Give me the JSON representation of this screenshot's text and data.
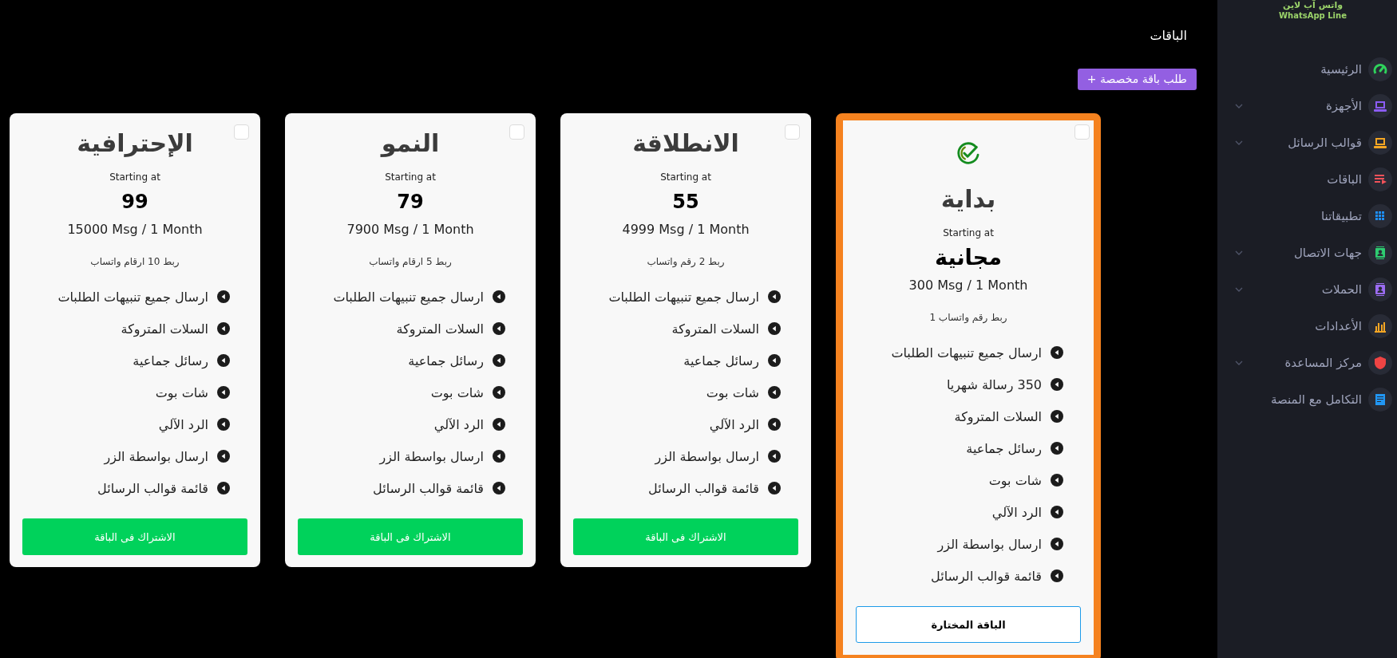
{
  "page_title": "الباقات",
  "custom_plan_button": "طلب باقة مخصصة +",
  "plans": [
    {
      "title": "بداية",
      "selected": true,
      "checked": false,
      "starting_label": "Starting at",
      "price": "مجانية",
      "quota": "300 Msg / 1 Month",
      "numbers": "ربط رقم واتساب 1",
      "features": [
        "ارسال جميع تنبيهات الطلبات",
        "350 رسالة شهريا",
        "السلات المتروكة",
        "رسائل جماعية",
        "شات بوت",
        "الرد الآلي",
        "ارسال بواسطة الزر",
        "قائمة قوالب الرسائل"
      ],
      "button": "الباقة المختارة"
    },
    {
      "title": "الانطلاقة",
      "selected": false,
      "checked": false,
      "starting_label": "Starting at",
      "price": "55",
      "quota": "4999 Msg / 1 Month",
      "numbers": "ربط 2 رقم واتساب",
      "features": [
        "ارسال جميع تنبيهات الطلبات",
        "السلات المتروكة",
        "رسائل جماعية",
        "شات بوت",
        "الرد الآلي",
        "ارسال بواسطة الزر",
        "قائمة قوالب الرسائل"
      ],
      "button": "الاشتراك فى الباقة"
    },
    {
      "title": "النمو",
      "selected": false,
      "checked": false,
      "starting_label": "Starting at",
      "price": "79",
      "quota": "7900 Msg / 1 Month",
      "numbers": "ربط 5 ارقام واتساب",
      "features": [
        "ارسال جميع تنبيهات الطلبات",
        "السلات المتروكة",
        "رسائل جماعية",
        "شات بوت",
        "الرد الآلي",
        "ارسال بواسطة الزر",
        "قائمة قوالب الرسائل"
      ],
      "button": "الاشتراك فى الباقة"
    },
    {
      "title": "الإحترافية",
      "selected": false,
      "checked": false,
      "starting_label": "Starting at",
      "price": "99",
      "quota": "15000 Msg / 1 Month",
      "numbers": "ربط 10 ارقام واتساب",
      "features": [
        "ارسال جميع تنبيهات الطلبات",
        "السلات المتروكة",
        "رسائل جماعية",
        "شات بوت",
        "الرد الآلي",
        "ارسال بواسطة الزر",
        "قائمة قوالب الرسائل"
      ],
      "button": "الاشتراك فى الباقة"
    }
  ],
  "sidebar": {
    "logo_arabic": "واتس آب لاين",
    "logo_english": "WhatsApp Line",
    "items": [
      {
        "label": "الرئيسية",
        "color": "#2fd35c",
        "has_submenu": false
      },
      {
        "label": "الأجهزة",
        "color": "#8b5cf6",
        "has_submenu": true
      },
      {
        "label": "قوالب الرسائل",
        "color": "#f5a623",
        "has_submenu": true
      },
      {
        "label": "الباقات",
        "color": "#f0525a",
        "has_submenu": false
      },
      {
        "label": "تطبيقاتنا",
        "color": "#1e90ff",
        "has_submenu": false
      },
      {
        "label": "جهات الاتصال",
        "color": "#2ecc71",
        "has_submenu": true
      },
      {
        "label": "الحملات",
        "color": "#9b6cf2",
        "has_submenu": true
      },
      {
        "label": "الأعدادات",
        "color": "#f5a623",
        "has_submenu": false
      },
      {
        "label": "مركز المساعدة",
        "color": "#ef4444",
        "has_submenu": true
      },
      {
        "label": "التكامل مع المنصة",
        "color": "#2196f3",
        "has_submenu": false
      }
    ]
  }
}
